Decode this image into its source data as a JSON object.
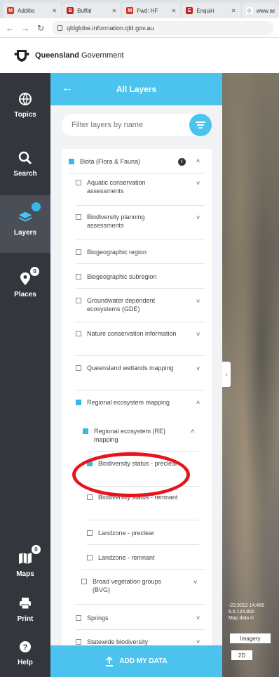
{
  "browser": {
    "tabs": [
      {
        "label": "Additio",
        "icon": "gmail-icon",
        "color": "#d93025",
        "glyph": "M"
      },
      {
        "label": "Buffal",
        "icon": "app-icon",
        "color": "#c5221f",
        "glyph": "B"
      },
      {
        "label": "Fwd: HF",
        "icon": "gmail-icon",
        "color": "#d93025",
        "glyph": "M"
      },
      {
        "label": "Enquiri",
        "icon": "app-icon",
        "color": "#c5221f",
        "glyph": "E"
      },
      {
        "label": "www.ae",
        "icon": "globe-icon",
        "color": "#5f6368",
        "glyph": "◎"
      }
    ],
    "url": "qldglobe.information.qld.gov.au"
  },
  "header": {
    "brand_bold": "Queensland",
    "brand_rest": " Government"
  },
  "sidebar": {
    "items": [
      {
        "label": "Topics",
        "icon": "topics-icon"
      },
      {
        "label": "Search",
        "icon": "search-icon"
      },
      {
        "label": "Layers",
        "icon": "layers-icon",
        "badge": ""
      },
      {
        "label": "Places",
        "icon": "pin-icon",
        "badge": "0"
      },
      {
        "label": "Maps",
        "icon": "map-icon",
        "badge": "0"
      },
      {
        "label": "Print",
        "icon": "printer-icon"
      },
      {
        "label": "Help",
        "icon": "help-icon"
      }
    ]
  },
  "panel": {
    "title": "All Layers",
    "search_placeholder": "Filter layers by name",
    "footer_label": "ADD MY DATA",
    "layers": [
      {
        "label": "Biota (Flora & Fauna)",
        "checked": true,
        "level": 0,
        "expanded": true
      },
      {
        "label": "Aquatic conservation assessments",
        "checked": false,
        "level": 1
      },
      {
        "label": "Biodiversity planning assessments",
        "checked": false,
        "level": 1
      },
      {
        "label": "Biogeographic region",
        "checked": false,
        "level": 1
      },
      {
        "label": "Biogeographic subregion",
        "checked": false,
        "level": 1
      },
      {
        "label": "Groundwater dependent ecosystems (GDE)",
        "checked": false,
        "level": 1
      },
      {
        "label": "Nature conservation information",
        "checked": false,
        "level": 1
      },
      {
        "label": "Queensland wetlands mapping",
        "checked": false,
        "level": 1
      },
      {
        "label": "Regional ecosystem mapping",
        "checked": true,
        "level": 1,
        "expanded": true
      },
      {
        "label": "Regional ecosystem (RE) mapping",
        "checked": true,
        "level": 2,
        "expanded": true
      },
      {
        "label": "Biodiversity status - preclear",
        "checked": true,
        "level": 3
      },
      {
        "label": "Biodiversity status - remnant",
        "checked": false,
        "level": 3
      },
      {
        "label": "Landzone - preclear",
        "checked": false,
        "level": 3
      },
      {
        "label": "Landzone - remnant",
        "checked": false,
        "level": 3
      },
      {
        "label": "Broad vegetation groups (BVG)",
        "checked": false,
        "level": 2
      },
      {
        "label": "Springs",
        "checked": false,
        "level": 1
      },
      {
        "label": "Statewide biodiversity",
        "checked": false,
        "level": 1
      }
    ]
  },
  "map": {
    "coords": "-23.9012 14.465\n6.6 124.802\nMap data ©",
    "buttons": [
      "Imagery",
      "2D"
    ]
  },
  "colors": {
    "accent": "#4cc3ee",
    "sidebar": "#33373d",
    "annotation": "#e8141c"
  }
}
